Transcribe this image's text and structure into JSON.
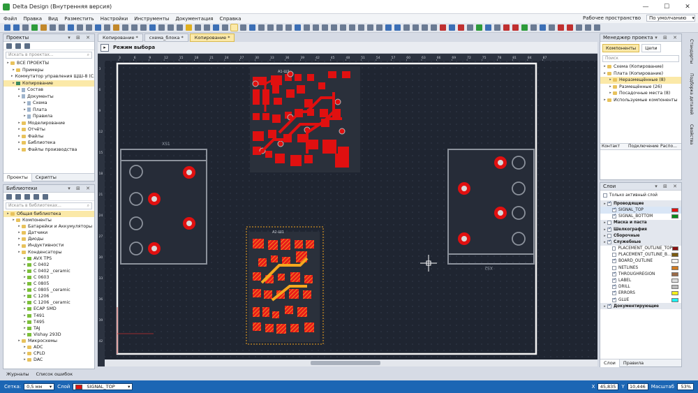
{
  "window": {
    "title": "Delta Design (Внутренняя версия)",
    "controls": [
      "—",
      "☐",
      "✕"
    ]
  },
  "menu": [
    "Файл",
    "Правка",
    "Вид",
    "Разместить",
    "Настройки",
    "Инструменты",
    "Документация",
    "Справка"
  ],
  "workspace": {
    "label": "Рабочее пространство",
    "value": "По умолчанию"
  },
  "projects_panel": {
    "title": "Проекты",
    "search_placeholder": "Искать в проектах...",
    "tree": [
      {
        "label": "ВСЕ ПРОЕКТЫ",
        "level": 0,
        "icon": "folder"
      },
      {
        "label": "Примеры",
        "level": 1,
        "icon": "folder"
      },
      {
        "label": "Коммутатор управления ЩШ-8 (С...",
        "level": 1,
        "icon": "project"
      },
      {
        "label": "Копирование",
        "level": 1,
        "icon": "project",
        "selected": true
      },
      {
        "label": "Состав",
        "level": 2,
        "icon": "doc"
      },
      {
        "label": "Документы",
        "level": 2,
        "icon": "doc"
      },
      {
        "label": "Схема",
        "level": 3,
        "icon": "doc"
      },
      {
        "label": "Плата",
        "level": 3,
        "icon": "doc"
      },
      {
        "label": "Правила",
        "level": 3,
        "icon": "doc"
      },
      {
        "label": "Моделирование",
        "level": 2,
        "icon": "folder"
      },
      {
        "label": "Отчёты",
        "level": 2,
        "icon": "folder"
      },
      {
        "label": "Файлы",
        "level": 2,
        "icon": "folder"
      },
      {
        "label": "Библиотека",
        "level": 2,
        "icon": "folder"
      },
      {
        "label": "Файлы производства",
        "level": 2,
        "icon": "folder"
      }
    ],
    "tabs": [
      "Проекты",
      "Скрипты"
    ]
  },
  "libraries_panel": {
    "title": "Библиотеки",
    "search_placeholder": "Искать в библиотеках...",
    "tree": [
      {
        "label": "Общая библиотека",
        "level": 0,
        "icon": "folder",
        "selected": true
      },
      {
        "label": "Компоненты",
        "level": 1,
        "icon": "folder"
      },
      {
        "label": "Батарейки и Аккумуляторы",
        "level": 2,
        "icon": "folder"
      },
      {
        "label": "Датчики",
        "level": 2,
        "icon": "folder"
      },
      {
        "label": "Диоды",
        "level": 2,
        "icon": "folder"
      },
      {
        "label": "Индуктивности",
        "level": 2,
        "icon": "folder"
      },
      {
        "label": "Конденсаторы",
        "level": 2,
        "icon": "folder"
      },
      {
        "label": "AVX TPS",
        "level": 3,
        "icon": "comp"
      },
      {
        "label": "C 0402",
        "level": 3,
        "icon": "comp"
      },
      {
        "label": "C 0402 _ceramic",
        "level": 3,
        "icon": "comp"
      },
      {
        "label": "C 0603",
        "level": 3,
        "icon": "comp"
      },
      {
        "label": "C 0805",
        "level": 3,
        "icon": "comp"
      },
      {
        "label": "C 0805 _ceramic",
        "level": 3,
        "icon": "comp"
      },
      {
        "label": "C 1206",
        "level": 3,
        "icon": "comp"
      },
      {
        "label": "C 1206 _ceramic",
        "level": 3,
        "icon": "comp"
      },
      {
        "label": "ECAP SMD",
        "level": 3,
        "icon": "comp"
      },
      {
        "label": "T491",
        "level": 3,
        "icon": "comp"
      },
      {
        "label": "T495",
        "level": 3,
        "icon": "comp"
      },
      {
        "label": "TAJ",
        "level": 3,
        "icon": "comp"
      },
      {
        "label": "Vishay 293D",
        "level": 3,
        "icon": "comp"
      },
      {
        "label": "Микросхемы",
        "level": 2,
        "icon": "folder"
      },
      {
        "label": "ADC",
        "level": 3,
        "icon": "folder"
      },
      {
        "label": "CPLD",
        "level": 3,
        "icon": "folder"
      },
      {
        "label": "DAC",
        "level": 3,
        "icon": "folder"
      }
    ],
    "tabs": [
      "Журналы",
      "Список ошибок"
    ]
  },
  "doc_tabs": [
    {
      "label": "Копирование *",
      "active": false
    },
    {
      "label": "схема_блока *",
      "active": false
    },
    {
      "label": "Копирование *",
      "active": true
    }
  ],
  "canvas": {
    "mode": "Режим выбора",
    "ruler_labels": [
      "3",
      "6",
      "9",
      "12",
      "15",
      "18",
      "21",
      "24",
      "27",
      "30",
      "33",
      "36",
      "39",
      "42",
      "45",
      "48",
      "51",
      "54",
      "57",
      "60",
      "63",
      "66",
      "69",
      "72",
      "75",
      "78",
      "81",
      "84",
      "87"
    ],
    "ruler_v_labels": [
      "3",
      "6",
      "9",
      "12",
      "15",
      "18",
      "21",
      "24",
      "27",
      "30",
      "33",
      "36",
      "39",
      "42"
    ],
    "component_labels": [
      "XS1",
      "XS2",
      "A1-Ш1",
      "A2-Ш1"
    ]
  },
  "project_manager": {
    "title": "Менеджер проекта",
    "tabs": [
      "Компоненты",
      "Цепи"
    ],
    "search_placeholder": "Поиск",
    "tree": [
      {
        "label": "Схема (Копирование)",
        "level": 0,
        "icon": "folder"
      },
      {
        "label": "Плата (Копирование)",
        "level": 0,
        "icon": "folder"
      },
      {
        "label": "Неразмещённые (8)",
        "level": 1,
        "icon": "folder",
        "selected": true
      },
      {
        "label": "Размещённые (26)",
        "level": 1,
        "icon": "folder"
      },
      {
        "label": "Посадочные места (8)",
        "level": 1,
        "icon": "folder"
      },
      {
        "label": "Используемые компоненты",
        "level": 0,
        "icon": "folder"
      }
    ],
    "columns": [
      "Контакт",
      "Подключение",
      "Распо..."
    ]
  },
  "layers_panel": {
    "title": "Слои",
    "only_active": "Только активный слой",
    "rows": [
      {
        "label": "Проводящие",
        "group": true,
        "checked": true,
        "color": ""
      },
      {
        "label": "SIGNAL_TOP",
        "group": false,
        "checked": true,
        "color": "#e01010",
        "selected": true
      },
      {
        "label": "SIGNAL_BOTTOM",
        "group": false,
        "checked": true,
        "color": "#0a8a1c"
      },
      {
        "label": "Маска и паста",
        "group": true,
        "checked": false,
        "color": ""
      },
      {
        "label": "Шелкография",
        "group": true,
        "checked": true,
        "color": ""
      },
      {
        "label": "Сборочные",
        "group": true,
        "checked": false,
        "color": ""
      },
      {
        "label": "Служебные",
        "group": true,
        "checked": true,
        "color": ""
      },
      {
        "label": "PLACEMENT_OUTLINE_TOP",
        "group": false,
        "checked": false,
        "color": "#8a1010"
      },
      {
        "label": "PLACEMENT_OUTLINE_B...",
        "group": false,
        "checked": false,
        "color": "#7a5a10"
      },
      {
        "label": "BOARD_OUTLINE",
        "group": false,
        "checked": true,
        "color": "#f3f3f3"
      },
      {
        "label": "NETLINES",
        "group": false,
        "checked": false,
        "color": "#d07a20"
      },
      {
        "label": "THROUGHREGION",
        "group": false,
        "checked": true,
        "color": "#9a6a48"
      },
      {
        "label": "LABEL",
        "group": false,
        "checked": true,
        "color": "#dddddd"
      },
      {
        "label": "DRILL",
        "group": false,
        "checked": true,
        "color": "#bdbdbd"
      },
      {
        "label": "ERRORS",
        "group": false,
        "checked": true,
        "color": "#f2ee1c"
      },
      {
        "label": "GLUE",
        "group": false,
        "checked": true,
        "color": "#1cf2f2"
      },
      {
        "label": "Документирующие",
        "group": true,
        "checked": true,
        "color": ""
      }
    ],
    "tabs": [
      "Слои",
      "Правила"
    ]
  },
  "side_labels": [
    "Стандарты",
    "Подборка деталей",
    "Свойства"
  ],
  "statusbar": {
    "grid_label": "Сетка:",
    "grid_value": "0,5 мм",
    "layer_label": "Слой",
    "layer_value": "SIGNAL_TOP",
    "layer_color": "#e01010",
    "x_label": "X",
    "x_value": "45,835",
    "y_label": "Y",
    "y_value": "10,446",
    "scale_label": "Масштаб",
    "scale_value": "53%"
  },
  "colors": {
    "accent": "#1c66b4",
    "canvas_bg": "#1f2531",
    "copper": "#e01010",
    "highlight": "#f5a81e"
  }
}
